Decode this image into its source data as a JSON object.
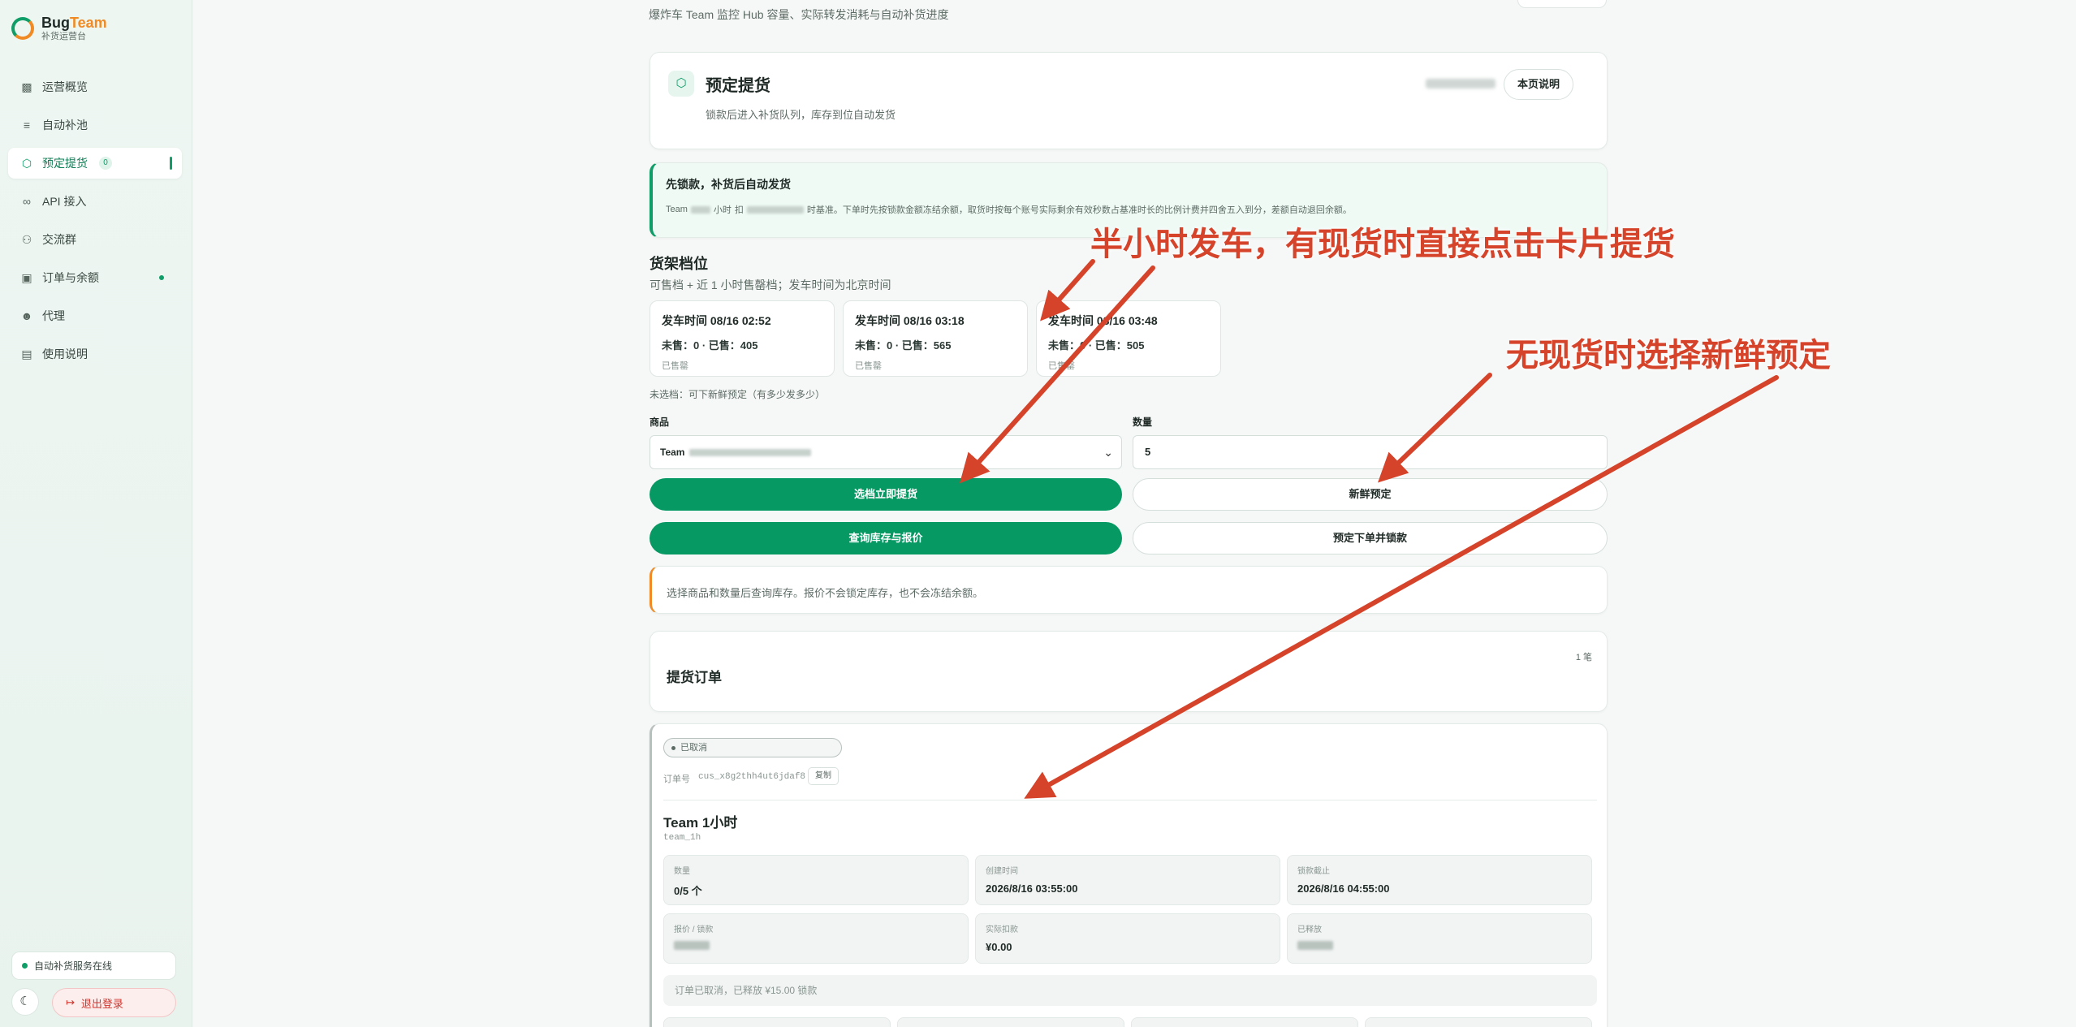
{
  "brand": {
    "name_part1": "Bug",
    "name_part2": "Team",
    "subtitle": "补货运营台"
  },
  "nav": {
    "items": [
      {
        "label": "运营概览",
        "icon": "bar-chart-icon"
      },
      {
        "label": "自动补池",
        "icon": "sliders-icon"
      },
      {
        "label": "预定提货",
        "icon": "cube-icon",
        "badge": "0",
        "active": true
      },
      {
        "label": "API 接入",
        "icon": "link-icon"
      },
      {
        "label": "交流群",
        "icon": "users-icon"
      },
      {
        "label": "订单与余额",
        "icon": "wallet-icon",
        "dot": true
      },
      {
        "label": "代理",
        "icon": "user-icon"
      },
      {
        "label": "使用说明",
        "icon": "document-icon"
      }
    ]
  },
  "sidebar_footer": {
    "status": "自动补货服务在线",
    "logout": "退出登录"
  },
  "top_line": "爆炸车 Team 监控 Hub 容量、实际转发消耗与自动补货进度",
  "header": {
    "title": "预定提货",
    "subtitle": "锁款后进入补货队列，库存到位自动发货",
    "help_button": "本页说明"
  },
  "notice": {
    "title": "先锁款，补货后自动发货",
    "text_part1": "Team",
    "text_part2": "小时",
    "text_part3": "扣",
    "text_part4": "时基准。下单时先按锁款金额冻结余额，取货时按每个账号实际剩余有效秒数占基准时长的比例计费并四舍五入到分，差额自动退回余额。"
  },
  "shelf": {
    "title": "货架档位",
    "subtitle": "可售档 + 近 1 小时售罄档；发车时间为北京时间",
    "slots": [
      {
        "time": "发车时间 08/16 02:52",
        "stock": "未售：0 · 已售：405",
        "state": "已售罄"
      },
      {
        "time": "发车时间 08/16 03:18",
        "stock": "未售：0 · 已售：565",
        "state": "已售罄"
      },
      {
        "time": "发车时间 08/16 03:48",
        "stock": "未售：0 · 已售：505",
        "state": "已售罄"
      }
    ],
    "unselected_note": "未选档：可下新鲜预定（有多少发多少）"
  },
  "form": {
    "product_label": "商品",
    "product_value_part1": "Team",
    "quantity_label": "数量",
    "quantity_value": "5",
    "btn_pick_now": "选档立即提货",
    "btn_fresh": "新鲜预定",
    "btn_query": "查询库存与报价",
    "btn_reserve": "预定下单并锁款"
  },
  "quote_note": "选择商品和数量后查询库存。报价不会锁定库存，也不会冻结余额。",
  "orders": {
    "title": "提货订单",
    "count": "1 笔",
    "list": [
      {
        "status": "已取消",
        "order_no_label": "订单号",
        "order_no": "cus_x8g2thh4ut6jdaf8",
        "copy_label": "复制",
        "product_name": "Team 1小时",
        "product_code": "team_1h",
        "fields": [
          {
            "label": "数量",
            "value": "0/5 个"
          },
          {
            "label": "创建时间",
            "value": "2026/8/16 03:55:00"
          },
          {
            "label": "锁款截止",
            "value": "2026/8/16 04:55:00"
          },
          {
            "label": "报价 / 锁款",
            "value": ""
          },
          {
            "label": "实际扣款",
            "value": "¥0.00"
          },
          {
            "label": "已释放",
            "value": ""
          }
        ],
        "note": "订单已取消，已释放 ¥15.00 锁款"
      }
    ]
  },
  "annotations": {
    "a1": "半小时发车，有现货时直接点击卡片提货",
    "a2": "无现货时选择新鲜预定",
    "color": "#d5432a"
  },
  "colors": {
    "accent": "#079964",
    "brand_orange": "#f08a24",
    "danger": "#d0342c"
  }
}
